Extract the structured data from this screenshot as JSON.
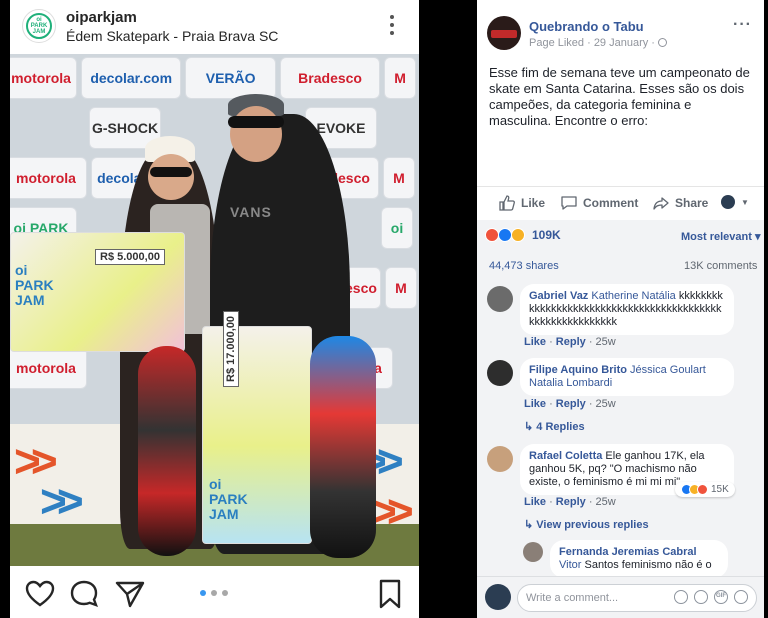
{
  "instagram": {
    "username": "oiparkjam",
    "location": "Édem Skatepark - Praia Brava SC",
    "avatar_text": "oi PARK JAM",
    "backdrop": {
      "row1": [
        "motorola",
        "decolar.com",
        "VERÃO",
        "Bradesco",
        "M"
      ],
      "row2": [
        "G-SHOCK",
        "EVOKE"
      ],
      "row3": [
        "motorola",
        "decolar",
        "Bradesco",
        "M"
      ],
      "row4": [
        "oi PARK",
        "oi"
      ],
      "row5": [
        "Bradesco",
        "M"
      ],
      "row6": [
        "motorola",
        "motorola"
      ]
    },
    "photo": {
      "check_small_amount": "R$ 5.000,00",
      "check_large_amount": "R$ 17.000,00",
      "check_brand": "oi PARK JAM",
      "shirt_text": "VANS"
    },
    "carousel": {
      "count": 3,
      "active": 0
    },
    "icons": [
      "heart-icon",
      "comment-icon",
      "share-icon",
      "bookmark-icon"
    ]
  },
  "facebook": {
    "page_name": "Quebrando o Tabu",
    "meta": "Page Liked · 29 January · ",
    "post_text": "Esse fim de semana teve um campeonato de skate em Santa Catarina. Esses são os dois campeões, da categoria feminina e masculina. Encontre o erro:",
    "actions": {
      "like": "Like",
      "comment": "Comment",
      "share": "Share"
    },
    "reactions": {
      "count": "109K",
      "colors": [
        "#f0533c",
        "#1877f2",
        "#f7b125"
      ]
    },
    "most_relevant": "Most relevant ▾",
    "shares": "44,473 shares",
    "comments_count": "13K comments",
    "comments": [
      {
        "name": "Gabriel Vaz",
        "tag": "Katherine Natália",
        "text": "kkkkkkkkkkkkkkkkkkkkkkkkkkkkkkkkkkkkkkkkkkkkkkkkkkkkkkkkkkk",
        "like": "Like",
        "reply": "Reply",
        "time": "25w"
      },
      {
        "name": "Filipe Aquino Brito",
        "tag": "Jéssica Goulart",
        "tag2": "Natalia Lombardi",
        "like": "Like",
        "reply": "Reply",
        "time": "25w",
        "replies": "4 Replies"
      },
      {
        "name": "Rafael Coletta",
        "text": "Ele ganhou 17K, ela ganhou 5K, pq? \"O machismo não existe, o feminismo é mi mi mi\"...",
        "like": "Like",
        "reply": "Reply",
        "time": "25w",
        "reaction_badge": "15K",
        "view_previous": "View previous replies"
      },
      {
        "name": "Fernanda Jeremias Cabral",
        "tag": "Vitor",
        "text": "Santos feminismo não é o"
      }
    ],
    "compose_placeholder": "Write a comment..."
  }
}
